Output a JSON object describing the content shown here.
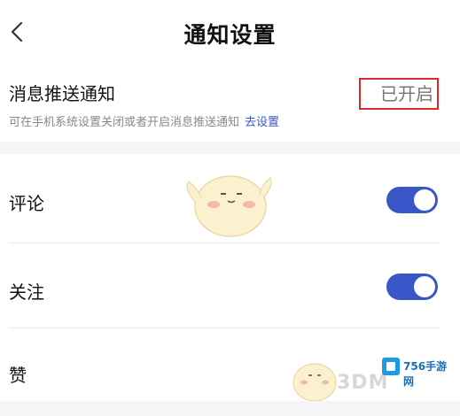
{
  "header": {
    "title": "通知设置",
    "back_icon": "chevron-left-icon"
  },
  "push": {
    "label": "消息推送通知",
    "status": "已开启",
    "hint": "可在手机系统设置关闭或者开启消息推送通知",
    "hint_link": "去设置",
    "highlight_color": "#e0262e"
  },
  "items": [
    {
      "label": "评论",
      "enabled": true
    },
    {
      "label": "关注",
      "enabled": true
    },
    {
      "label": "赞"
    }
  ],
  "colors": {
    "accent": "#3a57c9"
  },
  "watermarks": {
    "site_badge": "756手游网",
    "site_text": "3DM"
  }
}
